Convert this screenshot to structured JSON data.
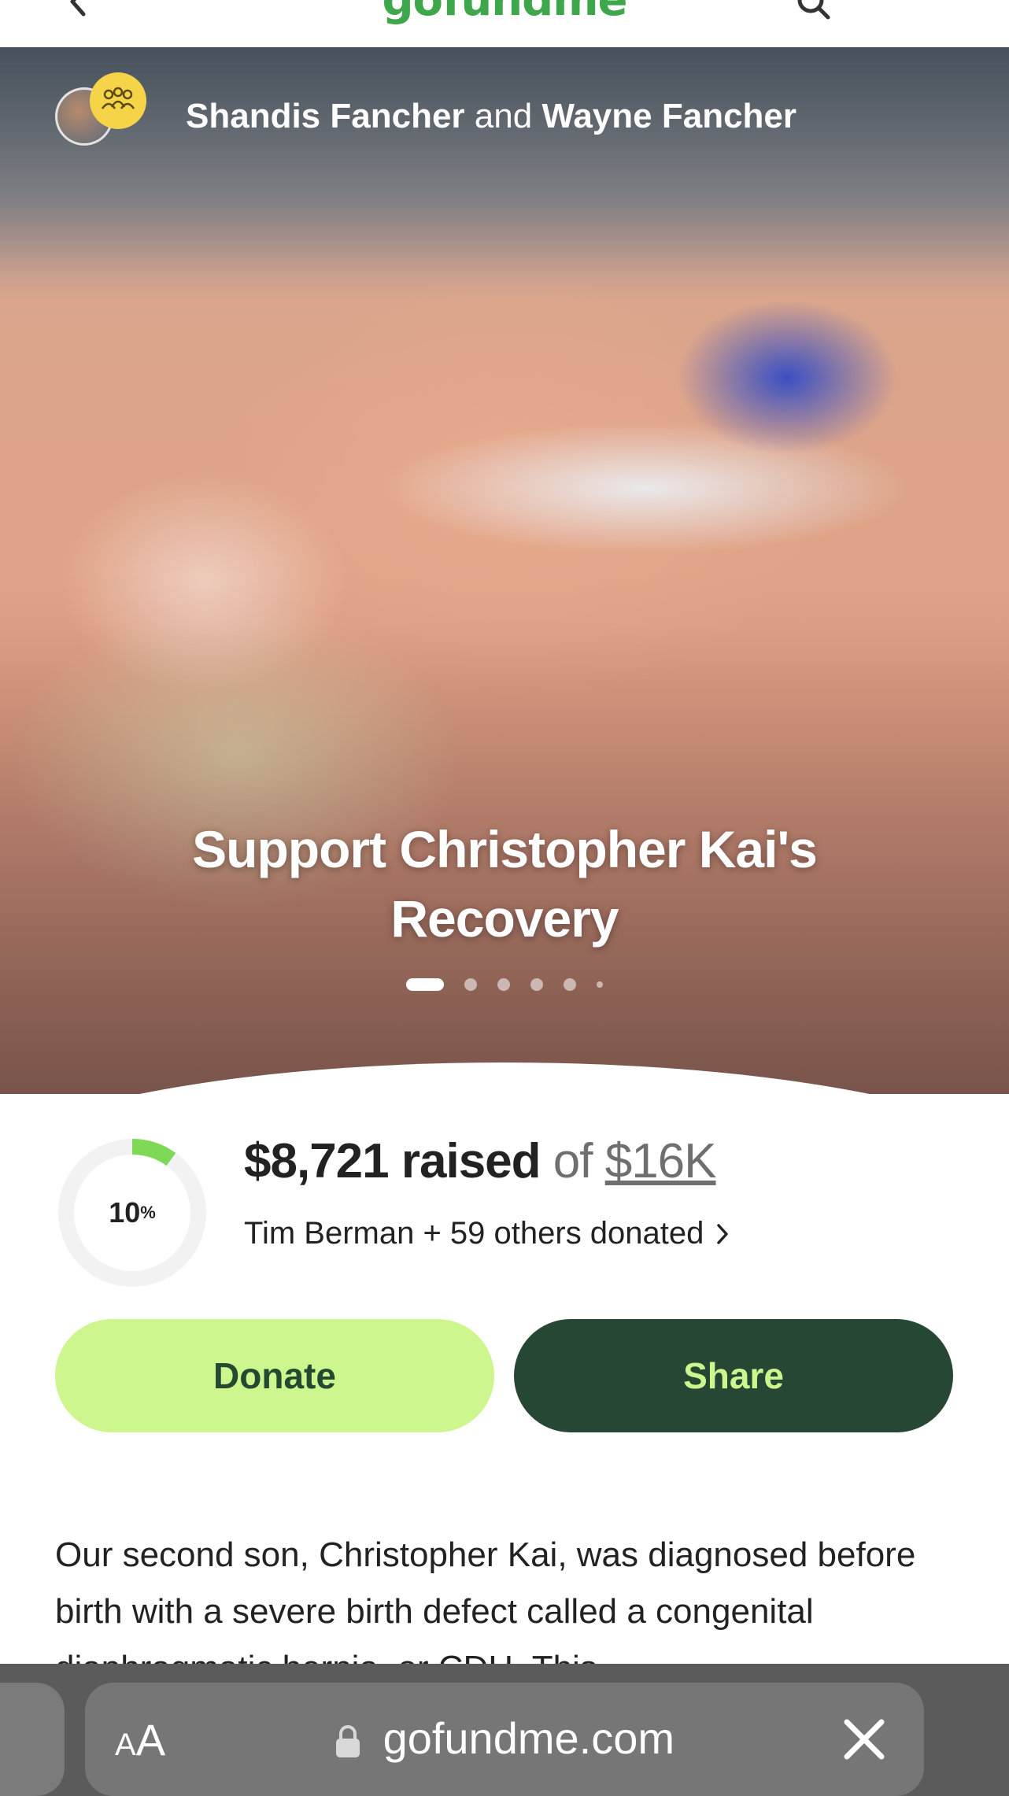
{
  "topbar": {
    "logo": "gofundme"
  },
  "hero": {
    "organizer_primary": "Shandis Fancher",
    "organizer_joiner": "and",
    "organizer_secondary": "Wayne Fancher",
    "title": "Support Christopher Kai's Recovery",
    "slides_total": 6,
    "slide_active_index": 0
  },
  "progress": {
    "percent": "10",
    "percent_symbol": "%",
    "fraction": 0.1,
    "raised_amount": "$8,721 raised",
    "of_label": "of",
    "goal": "$16K",
    "donors_text": "Tim Berman + 59 others donated"
  },
  "actions": {
    "donate_label": "Donate",
    "share_label": "Share"
  },
  "story": {
    "text": "Our second son, Christopher Kai, was diagnosed before birth with a severe birth defect called a congenital diaphragmatic hernia, or CDH. This"
  },
  "browser": {
    "text_size_label_small": "A",
    "text_size_label_large": "A",
    "url": "gofundme.com"
  },
  "colors": {
    "brand_green": "#3ea64b",
    "donate_bg": "#cdf78e",
    "share_bg": "#264733",
    "progress_ring": "#7ed957",
    "progress_track": "#f2f2f2"
  }
}
